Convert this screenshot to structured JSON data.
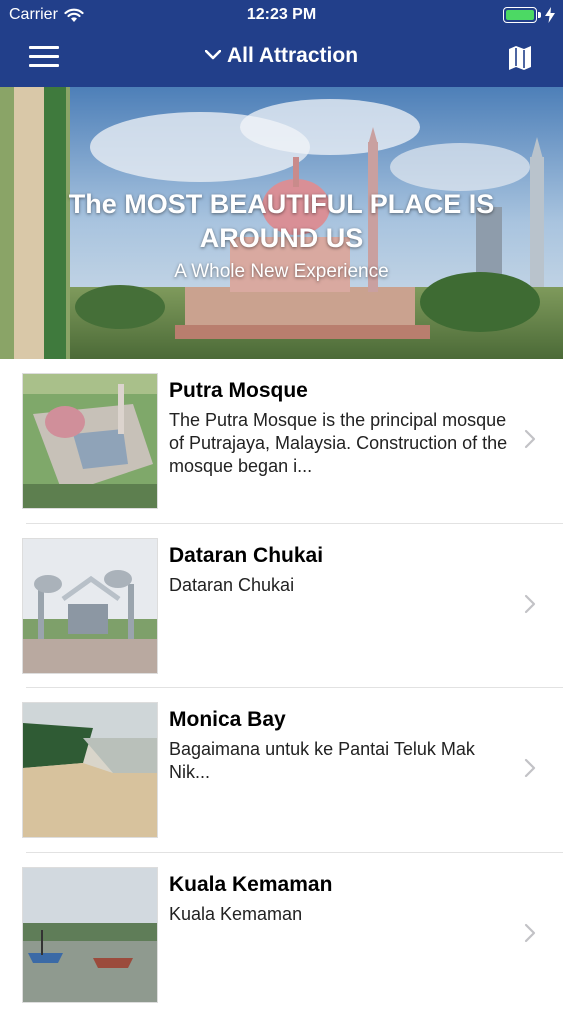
{
  "status_bar": {
    "carrier": "Carrier",
    "time": "12:23 PM"
  },
  "nav": {
    "title": "All Attraction",
    "menu_icon": "hamburger-menu-icon",
    "map_icon": "map-icon",
    "dropdown_icon": "chevron-down-icon"
  },
  "hero": {
    "title": "The MOST BEAUTIFUL PLACE IS AROUND US",
    "subtitle": "A Whole New Experience"
  },
  "attractions": [
    {
      "name": "Putra Mosque",
      "description": "The Putra Mosque is the principal mosque of Putrajaya, Malaysia. Construction of the mosque began i..."
    },
    {
      "name": "Dataran Chukai",
      "description": "Dataran Chukai"
    },
    {
      "name": "Monica Bay",
      "description": "Bagaimana untuk ke Pantai Teluk Mak Nik..."
    },
    {
      "name": "Kuala Kemaman",
      "description": "Kuala Kemaman"
    }
  ],
  "colors": {
    "nav_background": "#223f8a",
    "battery": "#4cd964"
  }
}
